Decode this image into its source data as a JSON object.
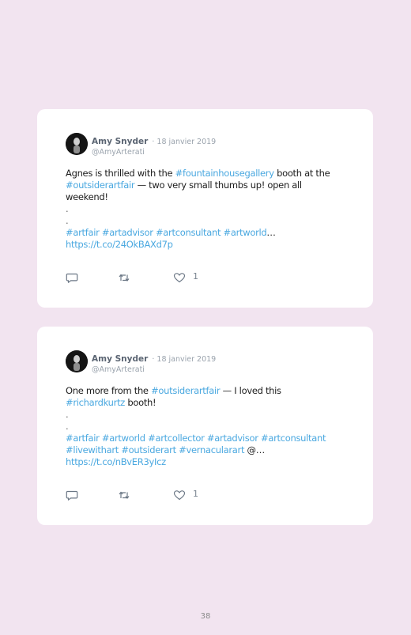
{
  "tweets": [
    {
      "author": "Amy Snyder",
      "date": "· 18 janvier 2019",
      "handle": "@AmyArterati",
      "line1_a": "Agnes is thrilled with the ",
      "line1_link": "#fountainhousegallery",
      "line1_b": " booth at the",
      "line2_link": "#outsiderartfair",
      "line2_b": " — two very small thumbs up! open all",
      "line3": "weekend!",
      "dots": [
        ".",
        "."
      ],
      "tags_line1": "#artfair #artadvisor #artconsultant #artworld",
      "tags_line1_tail": "…",
      "tags_line2": "",
      "tags_line2_tail": "",
      "url": "https://t.co/24OkBAXd7p",
      "likes": "1"
    },
    {
      "author": "Amy Snyder",
      "date": "· 18 janvier 2019",
      "handle": "@AmyArterati",
      "line1_a": "One more from the ",
      "line1_link": "#outsiderartfair",
      "line1_b": " — I loved this",
      "line2_link": "#richardkurtz",
      "line2_b": " booth!",
      "line3": "",
      "dots": [
        ".",
        "."
      ],
      "tags_line1": "#artfair #artworld #artcollector #artadvisor #artconsultant",
      "tags_line1_tail": "",
      "tags_line2": "#livewithart #outsiderart #vernacularart",
      "tags_line2_tail": " @…",
      "url": "https://t.co/nBvER3yIcz",
      "likes": "1"
    }
  ],
  "page_number": "38",
  "colors": {
    "background": "#f2e4f0",
    "card": "#ffffff",
    "link": "#4aa8e0",
    "name": "#5a6472",
    "meta": "#9aa3ad"
  },
  "icons": [
    "reply-icon",
    "retweet-icon",
    "like-icon"
  ]
}
